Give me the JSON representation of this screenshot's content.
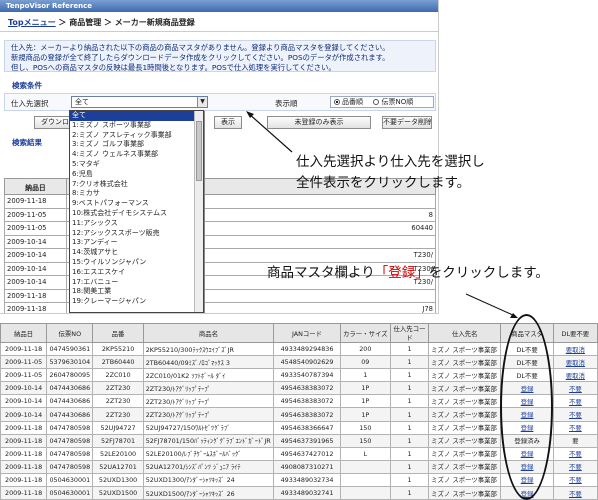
{
  "app": {
    "title": "TenpoVisor Reference"
  },
  "breadcrumb": {
    "top": "Topメニュー",
    "rest": " ＞ 商品管理 ＞ メーカー新規商品登録"
  },
  "notice": {
    "lines": [
      "仕入先：メーカーより納品された以下の商品の商品マスタがありません。登録より商品マスタを登録してください。",
      "新規商品の登録が全て終了したらダウンロードデータ作成をクリックしてください。POSのデータが作成されます。",
      "但し、POSへの商品マスタの反映は最長1時間後となります。POSで仕入処理を実行してください。"
    ]
  },
  "search": {
    "title": "検索条件",
    "supplier_label": "仕入先選択",
    "supplier_value": "全て",
    "sort_label": "表示順",
    "sort_option1": "品番順",
    "sort_option2": "伝票NO順"
  },
  "buttons": {
    "download": "ダウンロード",
    "show_all": "表示",
    "unregistered_only": "未登録のみ表示",
    "delete_unneeded": "不要データ削除"
  },
  "results": {
    "title": "検索結果",
    "header_date": "納品日",
    "dates": [
      "2009-11-18",
      "2009-11-05",
      "2009-11-05",
      "2009-10-14",
      "2009-10-14",
      "2009-10-14",
      "2009-10-14",
      "2009-11-18",
      "2009-11-18",
      "2009-11-18"
    ],
    "partial_values": [
      "",
      "8",
      "60440",
      "",
      "T230/",
      "T230/",
      "T230/",
      "",
      "J78",
      "J787"
    ]
  },
  "dropdown": {
    "items": [
      "全て",
      "1:ミズノ スポーツ事業部",
      "2:ミズノ アスレティック事業部",
      "3:ミズノ ゴルフ事業部",
      "4:ミズノ ウェルネス事業部",
      "5:マタギ",
      "6:児島",
      "7:クリオ株式会社",
      "8:ミカサ",
      "9:ベストパフォーマンス",
      "10:株式会社デイモシステムス",
      "11:アシックス",
      "12:アシックススポーツ販売",
      "13:アンディー",
      "14:茨城アサヒ",
      "15:ウイルソンジャパン",
      "16:エスエスケイ",
      "17:エバニュー",
      "18:関美工業",
      "19:クレーマージャパン"
    ]
  },
  "annotations": {
    "note1_line1": "仕入先選択より仕入先を選択し",
    "note1_line2": "全件表示をクリックします。",
    "note2_pre": "商品マスタ欄より",
    "note2_hl": "「登録」",
    "note2_post": "をクリックします。"
  },
  "table": {
    "headers": [
      "納品日",
      "伝票NO",
      "品番",
      "商品名",
      "JANコード",
      "カラー・サイズ",
      "仕入先コード",
      "仕入先名",
      "商品マスタ",
      "DL要不要"
    ],
    "rows": [
      [
        "2009-11-18",
        "0474590361",
        "2KP55210",
        "2KP55210/300ﾃｯｸｽｳｴｲﾌﾞｽﾞJR",
        "4933489294836",
        "200",
        "1",
        "ミズノ スポーツ事業部",
        "DL不要",
        "要取消"
      ],
      [
        "2009-11-05",
        "5379630104",
        "2TB60440",
        "2TB60440/09ﾐｽﾞﾉﾛｺﾞﾏｯｸｽ 3",
        "4548540902629",
        "09",
        "1",
        "ミズノ スポーツ事業部",
        "DL不要",
        "要取消"
      ],
      [
        "2009-11-05",
        "2604780095",
        "2ZC010",
        "2ZC010/01K2 ｿﾌﾄﾎﾞｰﾙ ﾀﾞｲ",
        "4933540787394",
        "1",
        "1",
        "ミズノ スポーツ事業部",
        "DL不要",
        "要取消"
      ],
      [
        "2009-10-14",
        "0474430686",
        "2ZT230",
        "2ZT230/ﾄｱｸﾞﾘｯﾌﾟﾃｰﾌﾟ",
        "4954638383072",
        "1P",
        "1",
        "ミズノ スポーツ事業部",
        "登録",
        "不要"
      ],
      [
        "2009-10-14",
        "0474430686",
        "2ZT230",
        "2ZT230/ﾄｱｸﾞﾘｯﾌﾟﾃｰﾌﾟ",
        "4954638383072",
        "1P",
        "1",
        "ミズノ スポーツ事業部",
        "登録",
        "不要"
      ],
      [
        "2009-10-14",
        "0474430686",
        "2ZT230",
        "2ZT230/ﾄｱｸﾞﾘｯﾌﾟﾃｰﾌﾟ",
        "4954638383072",
        "1P",
        "1",
        "ミズノ スポーツ事業部",
        "登録",
        "不要"
      ],
      [
        "2009-11-18",
        "0474780598",
        "52UJ94727",
        "52UJ94727/150ﾜﾙﾄｾﾞﾂｸﾞﾗﾌﾞ",
        "4954638366647",
        "150",
        "1",
        "ミズノ スポーツ事業部",
        "登録",
        "不要"
      ],
      [
        "2009-11-18",
        "0474780598",
        "52FJ78701",
        "52FJ78701/150ﾊﾞｯﾃｨﾝｸﾞｸﾞﾗﾌﾞｴﾝﾄﾞｶﾞｰﾄﾞJR",
        "4954637391965",
        "150",
        "1",
        "ミズノ スポーツ事業部",
        "登録済み",
        "要"
      ],
      [
        "2009-11-18",
        "0474780598",
        "52LE20100",
        "52LE20100/ﾚﾌﾞﾁｹﾞｰﾑｽﾎﾞｰﾙﾊﾞｯｸﾞ",
        "4954637427012",
        "L",
        "1",
        "ミズノ スポーツ事業部",
        "登録",
        "不要"
      ],
      [
        "2009-11-18",
        "0474780598",
        "52UA12701",
        "52UA12701/ｼﾝｽﾞﾊﾟﾝﾂ ｼﾞｭﾆｱ ﾗｲﾃ",
        "4908087310271",
        "",
        "1",
        "ミズノ スポーツ事業部",
        "登録",
        "不要"
      ],
      [
        "2009-11-18",
        "0504630001",
        "52UXD1300",
        "52UXD1300/ｱﾝﾀﾞｰｼｬﾂｷｯｽﾞ 24",
        "4933489032734",
        "",
        "1",
        "ミズノ スポーツ事業部",
        "登録",
        "不要"
      ],
      [
        "2009-11-18",
        "0504630001",
        "52UXD1500",
        "52UXD1500/ｱﾝﾀﾞｰｼｬﾂｷｯｽﾞ 26",
        "4933489032741",
        "",
        "1",
        "ミズノ スポーツ事業部",
        "登録",
        "不要"
      ]
    ]
  }
}
